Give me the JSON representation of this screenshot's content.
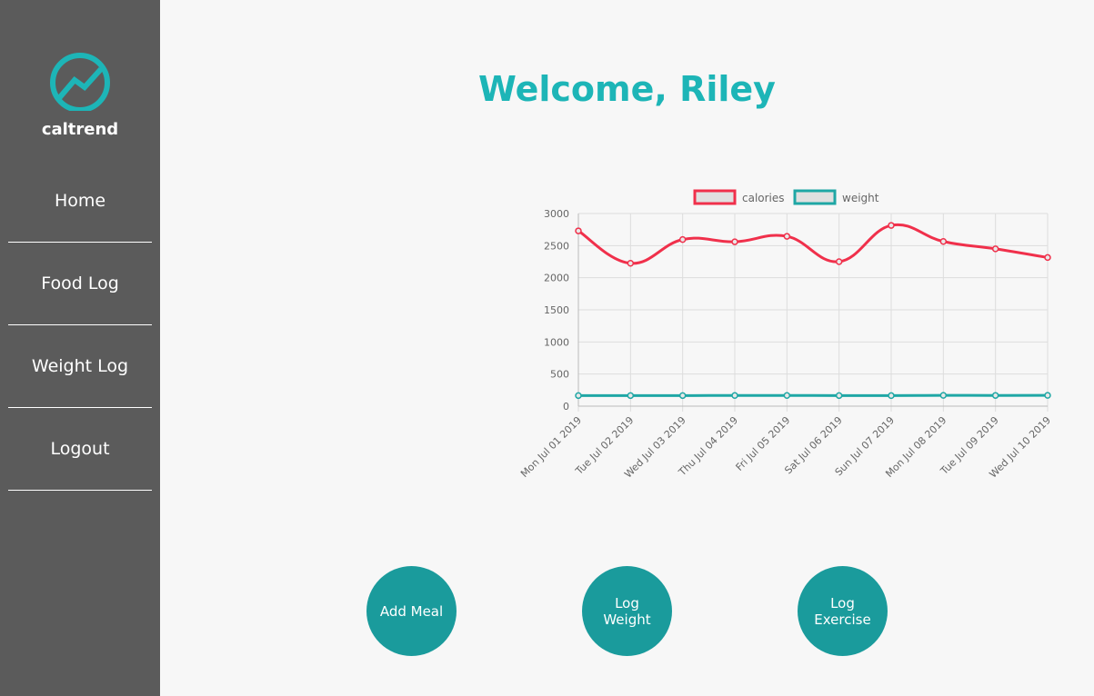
{
  "brand": {
    "name": "caltrend",
    "logo_icon": "trend-circle-icon",
    "accent": "#1db5b7"
  },
  "sidebar": {
    "items": [
      {
        "label": "Home"
      },
      {
        "label": "Food Log"
      },
      {
        "label": "Weight Log"
      },
      {
        "label": "Logout"
      }
    ]
  },
  "header": {
    "welcome": "Welcome, Riley"
  },
  "actions": [
    {
      "label": "Add Meal"
    },
    {
      "label": "Log Weight"
    },
    {
      "label": "Log Exercise"
    }
  ],
  "chart_data": {
    "type": "line",
    "x": [
      "Mon Jul 01 2019",
      "Tue Jul 02 2019",
      "Wed Jul 03 2019",
      "Thu Jul 04 2019",
      "Fri Jul 05 2019",
      "Sat Jul 06 2019",
      "Sun Jul 07 2019",
      "Mon Jul 08 2019",
      "Tue Jul 09 2019",
      "Wed Jul 10 2019"
    ],
    "series": [
      {
        "name": "calories",
        "color": "#f0304b",
        "values": [
          2730,
          2225,
          2595,
          2560,
          2645,
          2250,
          2815,
          2565,
          2450,
          2315
        ]
      },
      {
        "name": "weight",
        "color": "#1fa7a5",
        "values": [
          165,
          165,
          165,
          166,
          166,
          165,
          164,
          168,
          167,
          168
        ]
      }
    ],
    "yticks": [
      0,
      500,
      1000,
      1500,
      2000,
      2500,
      3000
    ],
    "ylim": [
      0,
      3000
    ],
    "grid": true,
    "legend": "top"
  }
}
